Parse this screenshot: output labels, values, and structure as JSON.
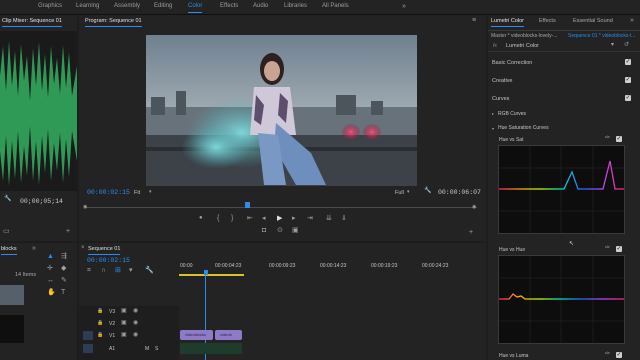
{
  "workspaces": [
    "Graphics",
    "Learning",
    "Assembly",
    "Editing",
    "Color",
    "Effects",
    "Audio",
    "Libraries",
    "All Panels"
  ],
  "active_workspace": "Color",
  "left_panel": {
    "tab": "Clip Mixer: Sequence 01",
    "timecode": "00;00;05;14"
  },
  "program": {
    "tab": "Program: Sequence 01",
    "timecode": "00:00:02:15",
    "fit": "Fit",
    "quality": "Full",
    "duration": "00:00:06:07"
  },
  "project": {
    "tab": "blocks",
    "count": "14 Items"
  },
  "timeline": {
    "tab": "Sequence 01",
    "timecode": "00:00:02:15",
    "ruler": [
      "00:00",
      "00:00:04:23",
      "00:00:09:23",
      "00:00:14:23",
      "00:00:19:23",
      "00:00:24:23"
    ],
    "video_tracks": [
      "V3",
      "V2",
      "V1"
    ],
    "audio_tracks": [
      "A1"
    ],
    "clip_labels": [
      "videoblocks",
      "videob"
    ]
  },
  "lumetri": {
    "tabs": [
      "Lumetri Color",
      "Effects",
      "Essential Sound"
    ],
    "master": "Master * videoblocks-lovely-...",
    "clip": "Sequence 01 * videoblocks-l...",
    "effect": "Lumetri Color",
    "sections": [
      "Basic Correction",
      "Creative",
      "Curves"
    ],
    "subsections": [
      "RGB Curves",
      "Hue Saturation Curves"
    ],
    "graphs": [
      "Hue vs Sat",
      "Hue vs Hue",
      "Hue vs Luma"
    ]
  },
  "colors": {
    "accent": "#2d8ceb",
    "panel": "#232323",
    "graph_bg": "#0d0d0d",
    "clip": "#8f7ac8"
  }
}
